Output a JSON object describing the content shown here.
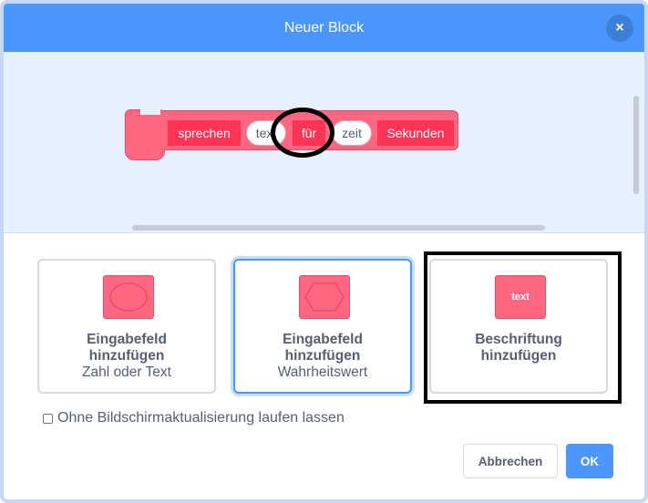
{
  "dialog": {
    "title": "Neuer Block",
    "close_label": "×"
  },
  "block": {
    "segments": [
      {
        "kind": "label",
        "text": "sprechen"
      },
      {
        "kind": "input",
        "text": "text"
      },
      {
        "kind": "label",
        "text": "für"
      },
      {
        "kind": "input",
        "text": "zeit"
      },
      {
        "kind": "label",
        "text": "Sekunden"
      }
    ]
  },
  "options": [
    {
      "title_line1": "Eingabefeld",
      "title_line2": "hinzufügen",
      "subtitle": "Zahl oder Text",
      "icon": "round-input-icon"
    },
    {
      "title_line1": "Eingabefeld",
      "title_line2": "hinzufügen",
      "subtitle": "Wahrheitswert",
      "icon": "hexagon-input-icon"
    },
    {
      "title_line1": "Beschriftung",
      "title_line2": "hinzufügen",
      "icon": "text-label-icon",
      "icon_text": "text"
    }
  ],
  "checkbox": {
    "label": "Ohne Bildschirmaktualisierung laufen lassen",
    "checked": false
  },
  "buttons": {
    "cancel": "Abbrechen",
    "ok": "OK"
  },
  "colors": {
    "header": "#4c97ff",
    "block": "#ff6680",
    "block_label": "#ff3355",
    "workspace": "#e6f0ff"
  }
}
